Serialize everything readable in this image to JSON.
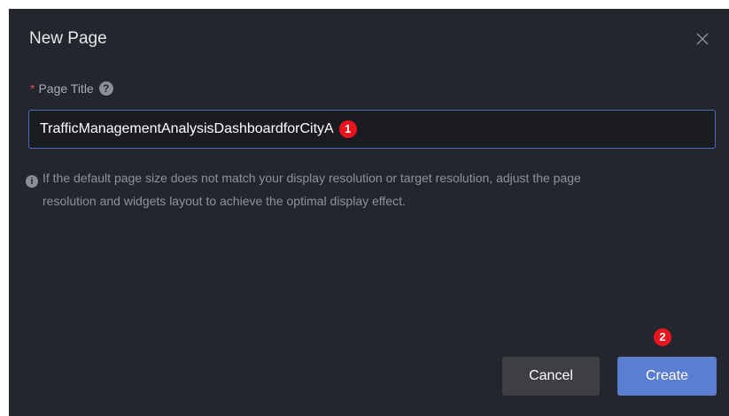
{
  "dialog": {
    "title": "New Page",
    "close_icon": "close-icon"
  },
  "form": {
    "page_title_label": "Page Title",
    "required_mark": "*",
    "help_icon": "question-mark-icon",
    "page_title_value": "TrafficManagementAnalysisDashboardforCityA"
  },
  "info": {
    "icon": "info-icon",
    "line1": "If the default page size does not match your display resolution or target resolution, adjust the page",
    "line2": "resolution and widgets layout to achieve the optimal display effect."
  },
  "buttons": {
    "cancel_label": "Cancel",
    "create_label": "Create"
  },
  "annotations": {
    "step1": "1",
    "step2": "2"
  },
  "colors": {
    "dialog_bg": "#24262d",
    "input_border": "#4a6db5",
    "primary_button": "#5b7ed1",
    "secondary_button": "#3d3f45",
    "badge": "#e8141e",
    "required": "#e0494f"
  }
}
